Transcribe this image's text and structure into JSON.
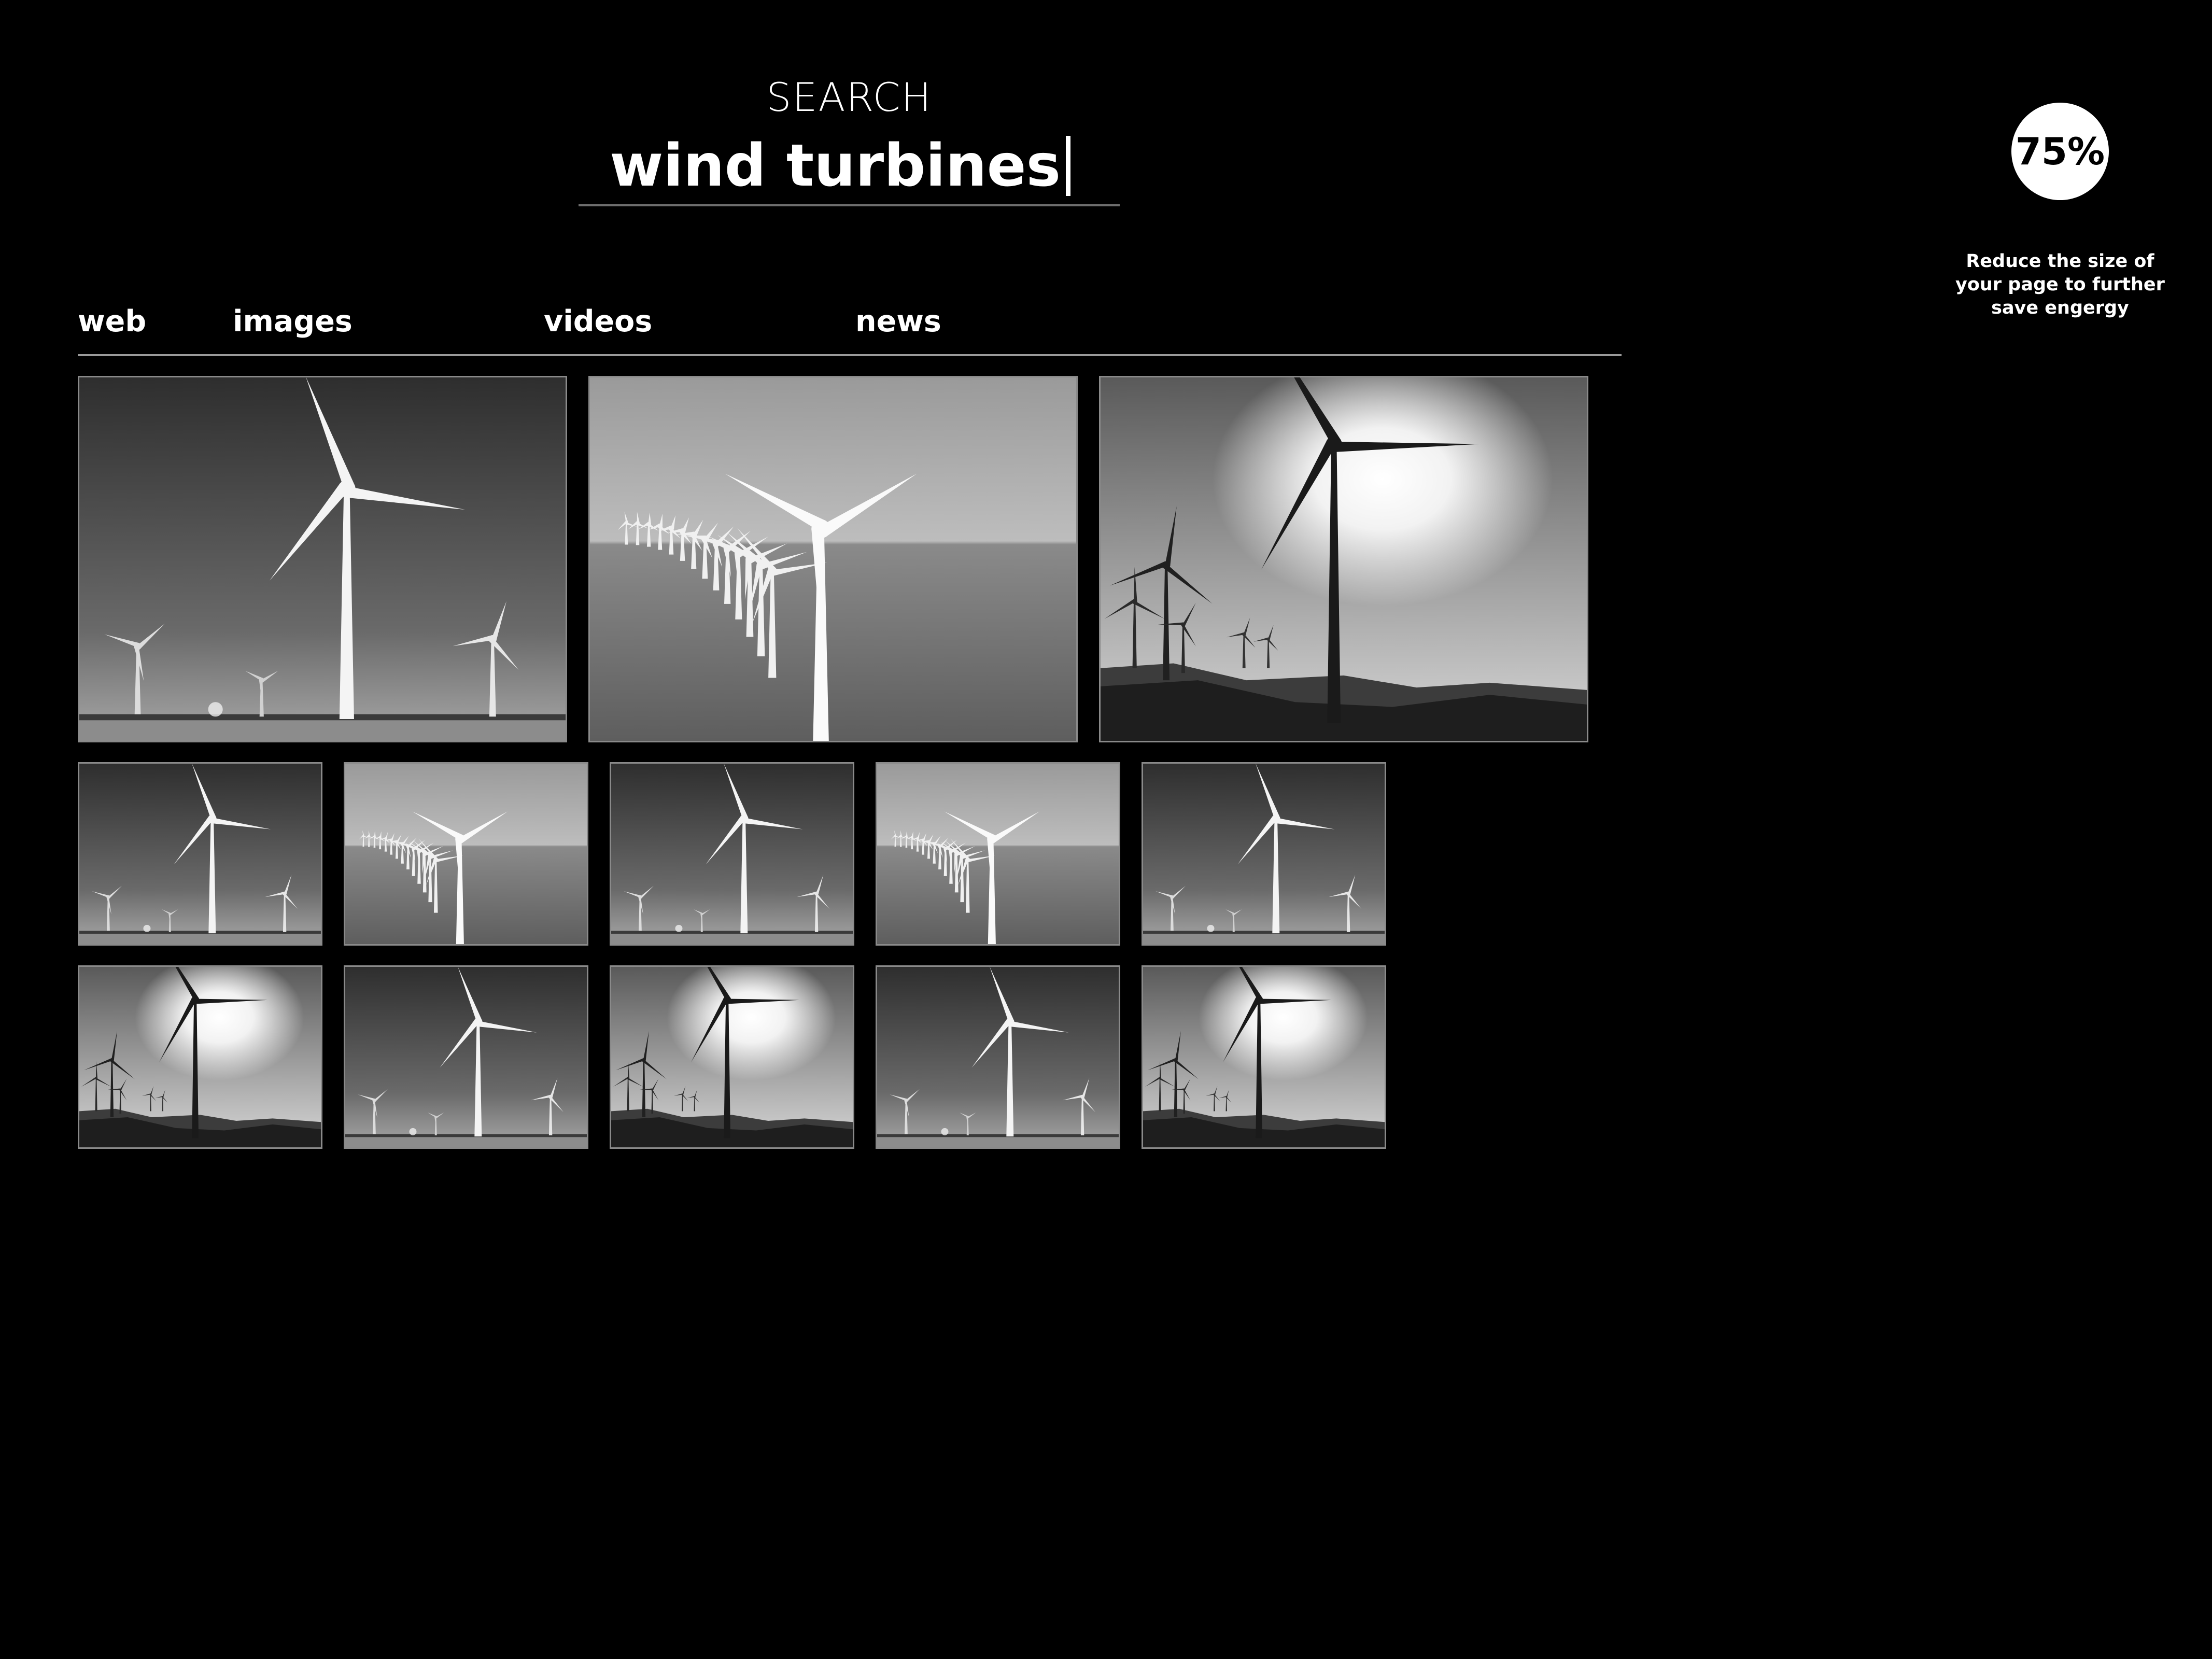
{
  "search": {
    "label": "SEARCH",
    "query": "wind turbines"
  },
  "energy": {
    "percent_label": "75%",
    "percent_value": 75,
    "note": "Reduce the size of your page to further save engergy"
  },
  "tabs": [
    {
      "label": "web"
    },
    {
      "label": "images"
    },
    {
      "label": "videos"
    },
    {
      "label": "news"
    }
  ],
  "results": {
    "row1": [
      "turbines-sky",
      "offshore-wind-farm",
      "turbines-sunlit-hills"
    ],
    "row2": [
      "turbines-sky",
      "offshore-wind-farm",
      "turbines-sky",
      "offshore-wind-farm",
      "turbines-sky"
    ],
    "row3": [
      "turbines-sunlit-hills",
      "turbines-sky",
      "turbines-sunlit-hills",
      "turbines-sky",
      "turbines-sunlit-hills"
    ]
  },
  "colors": {
    "background": "#000000",
    "text": "#ffffff",
    "divider": "#9a9a9a",
    "thumb_border": "#8a8a8a"
  }
}
